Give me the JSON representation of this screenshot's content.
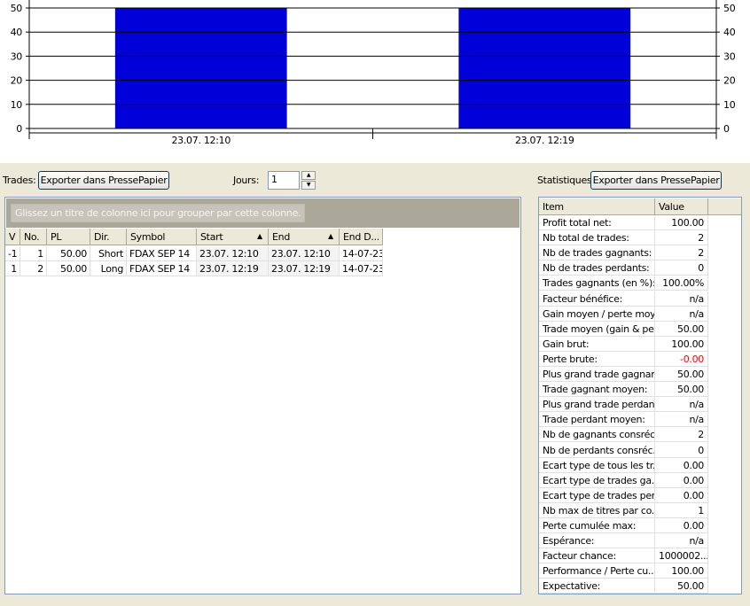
{
  "chart_data": {
    "type": "bar",
    "categories": [
      "23.07. 12:10",
      "23.07. 12:19"
    ],
    "values": [
      50,
      50
    ],
    "ylim": [
      0,
      50
    ],
    "yticks": [
      0,
      10,
      20,
      30,
      40,
      50
    ],
    "color": "#0000d8",
    "title": "",
    "xlabel": "",
    "ylabel": ""
  },
  "trades": {
    "label": "Trades:",
    "export": "Exporter dans PressePapier",
    "jours_label": "Jours:",
    "jours_value": "1",
    "group_hint": "Glissez un titre de colonne ici pour grouper par cette colonne.",
    "columns": [
      "V",
      "No.",
      "PL",
      "Dir.",
      "Symbol",
      "Start",
      "End",
      "End D..."
    ],
    "rows": [
      [
        "-1",
        "1",
        "50.00",
        "Short",
        "FDAX SEP 14",
        "23.07. 12:10",
        "23.07. 12:10",
        "14-07-23"
      ],
      [
        "1",
        "2",
        "50.00",
        "Long",
        "FDAX SEP 14",
        "23.07. 12:19",
        "23.07. 12:19",
        "14-07-23"
      ]
    ]
  },
  "stats": {
    "label": "Statistiques:",
    "export": "Exporter dans PressePapier",
    "columns": [
      "Item",
      "Value"
    ],
    "negative_color": "#ff0000",
    "rows": [
      [
        "Profit total net:",
        "100.00"
      ],
      [
        "Nb total de trades:",
        "2"
      ],
      [
        "Nb de trades gagnants:",
        "2"
      ],
      [
        "Nb de trades perdants:",
        "0"
      ],
      [
        "Trades gagnants (en %):",
        "100.00%"
      ],
      [
        "Facteur bénéfice:",
        "n/a"
      ],
      [
        "Gain moyen / perte moy...",
        "n/a"
      ],
      [
        "Trade moyen (gain & pe...",
        "50.00"
      ],
      [
        "Gain brut:",
        "100.00"
      ],
      [
        "Perte brute:",
        "-0.00"
      ],
      [
        "Plus grand trade gagnant:",
        "50.00"
      ],
      [
        "Trade gagnant moyen:",
        "50.00"
      ],
      [
        "Plus grand trade perdant:",
        "n/a"
      ],
      [
        "Trade perdant moyen:",
        "n/a"
      ],
      [
        "Nb de gagnants consréc...",
        "2"
      ],
      [
        "Nb de perdants consréc...",
        "0"
      ],
      [
        "Ecart type de tous les tr...",
        "0.00"
      ],
      [
        "Ecart type de trades ga...",
        "0.00"
      ],
      [
        "Ecart type de trades per...",
        "0.00"
      ],
      [
        "Nb max de titres par co...",
        "1"
      ],
      [
        "Perte cumulée max:",
        "0.00"
      ],
      [
        "Espérance:",
        "n/a"
      ],
      [
        "Facteur chance:",
        "1000002..."
      ],
      [
        "Performance / Perte cu...",
        "100.00"
      ],
      [
        "Expectative:",
        "50.00"
      ]
    ]
  }
}
